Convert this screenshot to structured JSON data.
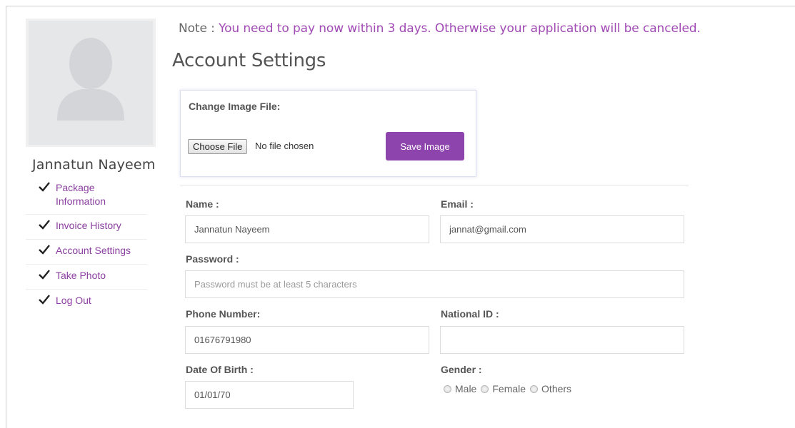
{
  "sidebar": {
    "user_name": "Jannatun Nayeem",
    "menu": [
      {
        "label": "Package Information",
        "icon": "check-icon"
      },
      {
        "label": "Invoice History",
        "icon": "check-icon"
      },
      {
        "label": "Account Settings",
        "icon": "check-icon"
      },
      {
        "label": "Take Photo",
        "icon": "check-icon"
      },
      {
        "label": "Log Out",
        "icon": "check-icon"
      }
    ]
  },
  "note": {
    "prefix": "Note : ",
    "message": "You need to pay now within 3 days. Otherwise your application will be canceled."
  },
  "page_title": "Account Settings",
  "image_box": {
    "title": "Change Image File:",
    "choose_file_label": "Choose File",
    "file_status": "No file chosen",
    "save_label": "Save Image"
  },
  "form": {
    "name": {
      "label": "Name :",
      "value": "Jannatun Nayeem"
    },
    "email": {
      "label": "Email :",
      "value": "jannat@gmail.com"
    },
    "password": {
      "label": "Password :",
      "value": "",
      "placeholder": "Password must be at least 5 characters"
    },
    "phone": {
      "label": "Phone Number:",
      "value": "01676791980"
    },
    "national_id": {
      "label": "National ID :",
      "value": ""
    },
    "dob": {
      "label": "Date Of Birth :",
      "value": "01/01/70"
    },
    "gender": {
      "label": "Gender :",
      "options": [
        "Male",
        "Female",
        "Others"
      ]
    }
  },
  "colors": {
    "accent": "#8e44ad",
    "link": "#8b3fa0",
    "note_message": "#a04ab4"
  }
}
